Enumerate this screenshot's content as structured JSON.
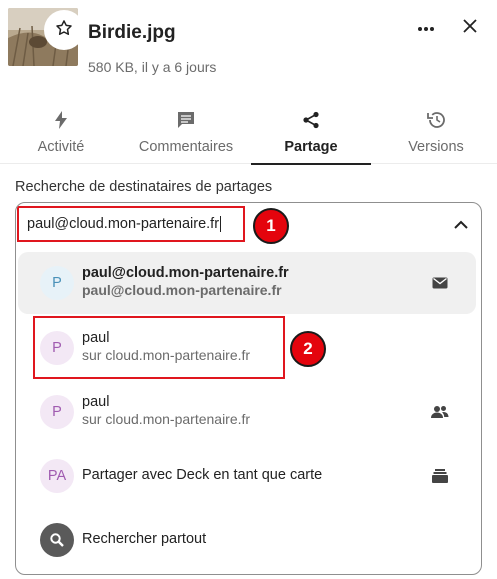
{
  "file": {
    "name": "Birdie.jpg",
    "meta": "580 KB, il y a 6 jours"
  },
  "header": {
    "favorite_icon": "star-icon",
    "more_icon": "more-horizontal-icon",
    "close_icon": "close-icon"
  },
  "tabs": [
    {
      "label": "Activité",
      "icon": "lightning-icon",
      "active": false
    },
    {
      "label": "Commentaires",
      "icon": "comment-icon",
      "active": false
    },
    {
      "label": "Partage",
      "icon": "share-icon",
      "active": true
    },
    {
      "label": "Versions",
      "icon": "history-icon",
      "active": false
    }
  ],
  "sharing": {
    "search_label": "Recherche de destinataires de partages",
    "search_value": "paul@cloud.mon-partenaire.fr",
    "options": [
      {
        "avatar": "P",
        "title": "paul@cloud.mon-partenaire.fr",
        "subtitle": "paul@cloud.mon-partenaire.fr",
        "icon": "email-icon"
      },
      {
        "avatar": "P",
        "title": "paul",
        "subtitle": "sur cloud.mon-partenaire.fr",
        "icon": ""
      },
      {
        "avatar": "P",
        "title": "paul",
        "subtitle": "sur cloud.mon-partenaire.fr",
        "icon": "group-icon"
      },
      {
        "avatar": "PA",
        "title": "Partager avec Deck en tant que carte",
        "subtitle": "",
        "icon": "deck-icon"
      },
      {
        "avatar": "",
        "title": "Rechercher partout",
        "subtitle": "",
        "icon": ""
      }
    ]
  },
  "annotations": {
    "step1": "1",
    "step2": "2",
    "color": "#e0161e"
  }
}
